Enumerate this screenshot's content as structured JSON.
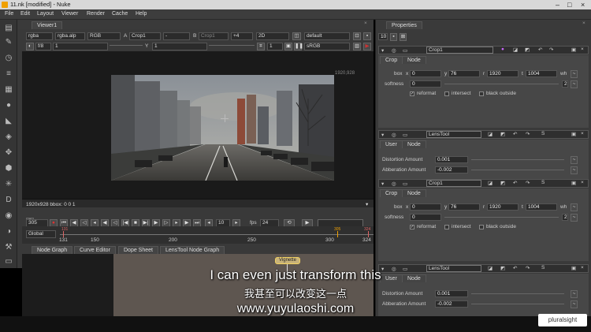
{
  "window": {
    "title": "11.nk [modified] - Nuke"
  },
  "menubar": {
    "items": [
      "File",
      "Edit",
      "Layout",
      "Viewer",
      "Render",
      "Cache",
      "Help"
    ]
  },
  "viewer": {
    "tab_label": "Viewer1",
    "controls": {
      "channels": "rgba",
      "alpha_channel": "rgba.alp",
      "display_channel": "RGB",
      "input_a_label": "A",
      "input_a": "Crop1",
      "input_op": "-",
      "input_b_label": "B",
      "input_b": "Crop1",
      "gain": "+4",
      "view_mode": "2D",
      "lut": "default",
      "fstop": "f/8",
      "gain_value": "1",
      "gamma_label": "Y",
      "gamma_value": "1",
      "proxy": "1",
      "colorspace": "sRGB"
    },
    "format_label": "1920,928",
    "status_text": "1920x928 bbox: 0 0 1"
  },
  "transport": {
    "frame": "305",
    "step": "10",
    "fps_label": "fps",
    "fps": "24"
  },
  "timeline": {
    "scope": "Global",
    "in_marker": "131",
    "current_marker": "305",
    "out_marker": "324",
    "ticks": [
      "131",
      "150",
      "200",
      "250",
      "300",
      "324"
    ]
  },
  "nodegraph": {
    "tabs": [
      "Node Graph",
      "Curve Editor",
      "Dope Sheet",
      "LensTool Node Graph"
    ],
    "node_label": "Vignette"
  },
  "properties": {
    "title": "Properties",
    "max_panels": "10",
    "nodes": [
      {
        "name": "Crop1",
        "tabs": [
          "Crop",
          "Node"
        ],
        "box_label": "box",
        "box": {
          "x_label": "x",
          "x": "0",
          "y_label": "y",
          "y": "76",
          "r_label": "r",
          "r": "1920",
          "t_label": "t",
          "t": "1004",
          "wh": "wh"
        },
        "softness_label": "softness",
        "softness": "0",
        "count": "2",
        "checks": [
          {
            "label": "reformat",
            "checked": true
          },
          {
            "label": "intersect",
            "checked": false
          },
          {
            "label": "black outside",
            "checked": false
          }
        ]
      },
      {
        "name": "LensTool",
        "tabs": [
          "User",
          "Node"
        ],
        "distortion_label": "Distortion Amount",
        "distortion": "0.001",
        "abberation_label": "Abberation Amount",
        "abberation": "-0.002"
      },
      {
        "name": "Crop1",
        "tabs": [
          "Crop",
          "Node"
        ],
        "box_label": "box",
        "box": {
          "x_label": "x",
          "x": "0",
          "y_label": "y",
          "y": "76",
          "r_label": "r",
          "r": "1920",
          "t_label": "t",
          "t": "1004",
          "wh": "wh"
        },
        "softness_label": "softness",
        "softness": "0",
        "count": "2",
        "checks": [
          {
            "label": "reformat",
            "checked": true
          },
          {
            "label": "intersect",
            "checked": false
          },
          {
            "label": "black outside",
            "checked": false
          }
        ]
      },
      {
        "name": "LensTool",
        "tabs": [
          "User",
          "Node"
        ],
        "distortion_label": "Distortion Amount",
        "distortion": "0.001",
        "abberation_label": "Abberation Amount",
        "abberation": "-0.002"
      }
    ]
  },
  "subtitles": {
    "english": "I can even just transform this",
    "chinese": "我甚至可以改变这一点",
    "url": "www.yuyulaoshi.com"
  },
  "watermark": "pluralsight"
}
